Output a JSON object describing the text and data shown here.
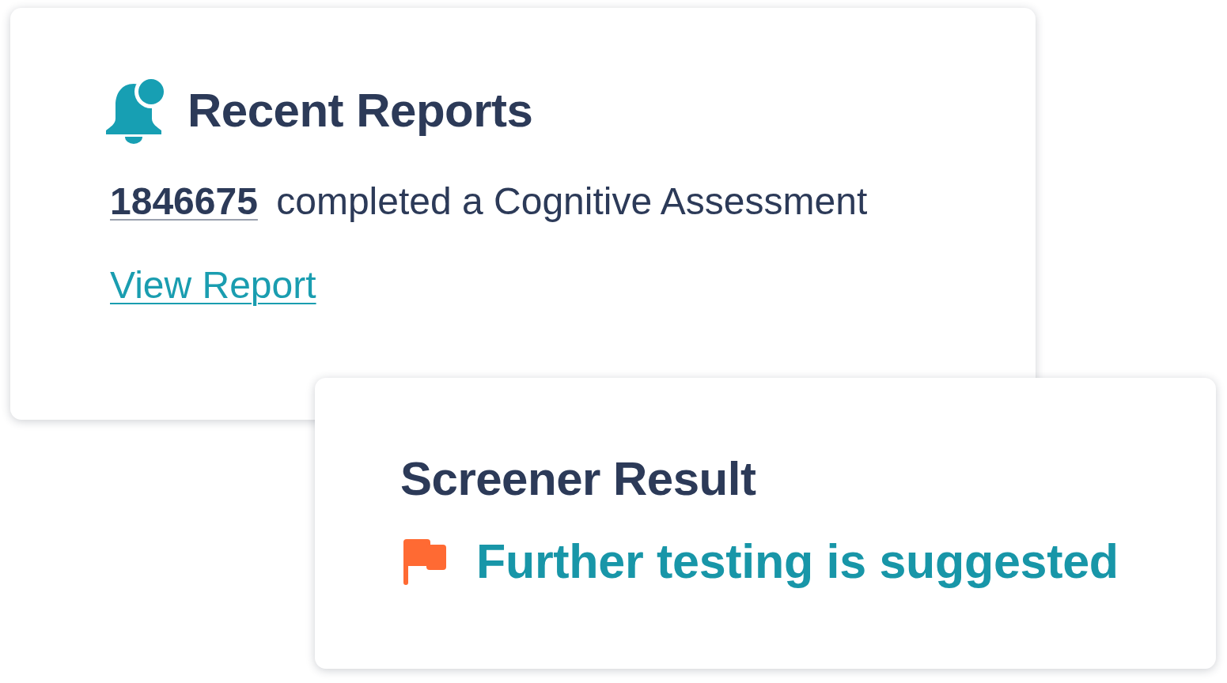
{
  "recent_reports": {
    "title": "Recent Reports",
    "patient_id": "1846675",
    "message": "completed a Cognitive Assessment",
    "link": "View Report"
  },
  "screener_result": {
    "title": "Screener Result",
    "result": "Further testing is suggested"
  }
}
